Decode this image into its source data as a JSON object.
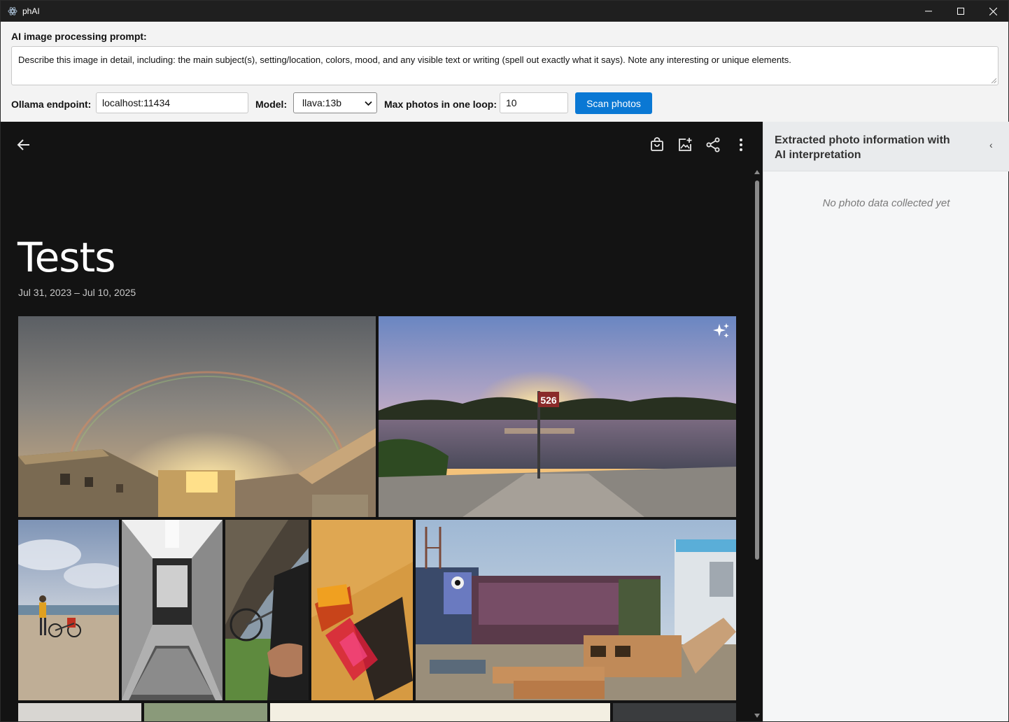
{
  "window": {
    "title": "phAI"
  },
  "controls": {
    "prompt_label": "AI image processing prompt:",
    "prompt_value": "Describe this image in detail, including: the main subject(s), setting/location, colors, mood, and any visible text or writing (spell out exactly what it says). Note any interesting or unique elements.",
    "endpoint_label": "Ollama endpoint:",
    "endpoint_value": "localhost:11434",
    "model_label": "Model:",
    "model_value": "llava:13b",
    "max_label": "Max photos in one loop:",
    "max_value": "10",
    "scan_button": "Scan photos"
  },
  "viewer": {
    "album_title": "Tests",
    "album_dates": "Jul 31, 2023 – Jul 10, 2025",
    "toolbar_icons": [
      "back-icon",
      "shopping-bag-icon",
      "add-photo-icon",
      "share-icon",
      "more-vert-icon"
    ],
    "photos": [
      "rainbow-over-buildings",
      "sunset-over-river",
      "cyclist-on-beach",
      "black-white-hallway",
      "bicycle-from-tent",
      "prism-on-wood",
      "construction-site-graffiti",
      "bottom-row-photo-1",
      "bottom-row-photo-2",
      "bottom-row-photo-3",
      "bottom-row-photo-4"
    ]
  },
  "side_panel": {
    "title": "Extracted photo information with AI interpretation",
    "collapse_label": "‹",
    "empty_message": "No photo data collected yet"
  }
}
